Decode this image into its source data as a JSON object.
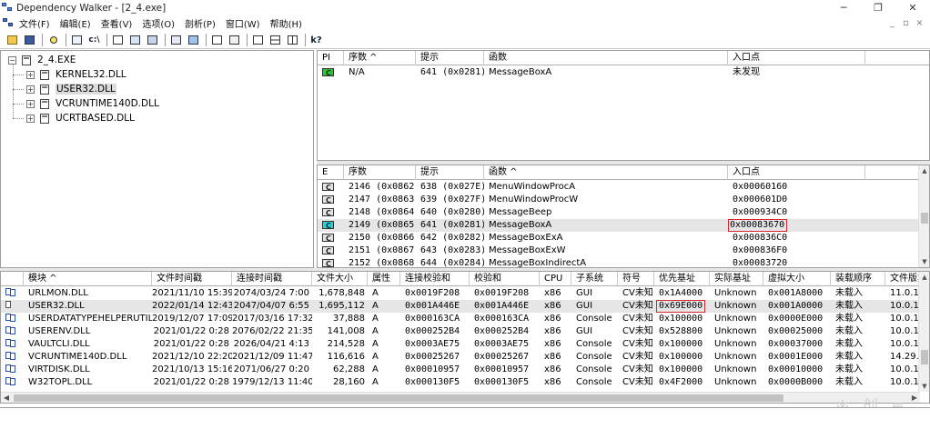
{
  "window": {
    "title": "Dependency Walker - [2_4.exe]",
    "controls": [
      "─",
      "❐",
      "✕"
    ]
  },
  "menu": {
    "items": [
      "文件(F)",
      "编辑(E)",
      "查看(V)",
      "选项(O)",
      "剖析(P)",
      "窗口(W)",
      "帮助(H)"
    ],
    "mdi_controls": [
      "_",
      "▫",
      "×"
    ]
  },
  "tree": {
    "root": "2_4.EXE",
    "children": [
      "KERNEL32.DLL",
      "USER32.DLL",
      "VCRUNTIME140D.DLL",
      "UCRTBASED.DLL"
    ],
    "selected_index": 1
  },
  "imports": {
    "headers": [
      "PI",
      "序数 ^",
      "提示",
      "函数",
      "入口点"
    ],
    "rows": [
      {
        "ordinal": "N/A",
        "hint": "641 (0x0281)",
        "function": "MessageBoxA",
        "entry": "未发现"
      }
    ]
  },
  "exports": {
    "headers": [
      "E",
      "序数",
      "提示",
      "函数 ^",
      "入口点"
    ],
    "rows": [
      {
        "ordinal": "2146 (0x0862)",
        "hint": "638 (0x027E)",
        "function": "MenuWindowProcA",
        "entry": "0x00060160"
      },
      {
        "ordinal": "2147 (0x0863)",
        "hint": "639 (0x027F)",
        "function": "MenuWindowProcW",
        "entry": "0x000601D0"
      },
      {
        "ordinal": "2148 (0x0864)",
        "hint": "640 (0x0280)",
        "function": "MessageBeep",
        "entry": "0x000934C0"
      },
      {
        "ordinal": "2149 (0x0865)",
        "hint": "641 (0x0281)",
        "function": "MessageBoxA",
        "entry": "0x00083670"
      },
      {
        "ordinal": "2150 (0x0866)",
        "hint": "642 (0x0282)",
        "function": "MessageBoxExA",
        "entry": "0x000836C0"
      },
      {
        "ordinal": "2151 (0x0867)",
        "hint": "643 (0x0283)",
        "function": "MessageBoxExW",
        "entry": "0x000836F0"
      },
      {
        "ordinal": "2152 (0x0868)",
        "hint": "644 (0x0284)",
        "function": "MessageBoxIndirectA",
        "entry": "0x00083720"
      }
    ],
    "highlighted_index": 3
  },
  "modules": {
    "headers": [
      "",
      "模块 ^",
      "文件时间戳",
      "连接时间戳",
      "文件大小",
      "属性",
      "连接校验和",
      "校验和",
      "CPU",
      "子系统",
      "符号",
      "优先基址",
      "实际基址",
      "虚拟大小",
      "装载顺序",
      "文件版本"
    ],
    "rows": [
      [
        "URLMON.DLL",
        "2021/11/10 15:39",
        "2074/03/24  7:00",
        "1,678,848",
        "A",
        "0x0019F208",
        "0x0019F208",
        "x86",
        "GUI",
        "CV未知",
        "0x1A4000",
        "Unknown",
        "0x001A8000",
        "未载入",
        "11.0.1"
      ],
      [
        "USER32.DLL",
        "2022/01/14 12:43",
        "2047/04/07  6:55",
        "1,695,112",
        "A",
        "0x001A446E",
        "0x001A446E",
        "x86",
        "GUI",
        "CV未知",
        "0x69E000",
        "Unknown",
        "0x001A0000",
        "未载入",
        "10.0.1"
      ],
      [
        "USERDATATYPEHELPERUTIL",
        "2019/12/07 17:09",
        "2017/03/16 17:32",
        "37,888",
        "A",
        "0x000163CA",
        "0x000163CA",
        "x86",
        "Console",
        "CV未知",
        "0x100000",
        "Unknown",
        "0x0000E000",
        "未载入",
        "10.0.1"
      ],
      [
        "USERENV.DLL",
        "2021/01/22  0:28",
        "2076/02/22 21:35",
        "141,008",
        "A",
        "0x000252B4",
        "0x000252B4",
        "x86",
        "GUI",
        "CV未知",
        "0x528800",
        "Unknown",
        "0x00025000",
        "未载入",
        "10.0.1"
      ],
      [
        "VAULTCLI.DLL",
        "2021/01/22  0:28",
        "2026/04/21  4:13",
        "214,528",
        "A",
        "0x0003AE75",
        "0x0003AE75",
        "x86",
        "Console",
        "CV未知",
        "0x100000",
        "Unknown",
        "0x00037000",
        "未载入",
        "10.0.1"
      ],
      [
        "VCRUNTIME140D.DLL",
        "2021/12/10 22:20",
        "2021/12/09 11:47",
        "116,616",
        "A",
        "0x00025267",
        "0x00025267",
        "x86",
        "Console",
        "CV未知",
        "0x100000",
        "Unknown",
        "0x0001E000",
        "未载入",
        "14.29."
      ],
      [
        "VIRTDISK.DLL",
        "2021/10/13 15:16",
        "2071/06/27  0:20",
        "62,288",
        "A",
        "0x00010957",
        "0x00010957",
        "x86",
        "Console",
        "CV未知",
        "0x100000",
        "Unknown",
        "0x00010000",
        "未载入",
        "10.0.1"
      ],
      [
        "W32TOPL.DLL",
        "2021/01/22  0:28",
        "1979/12/13 11:40",
        "28,160",
        "A",
        "0x000130F5",
        "0x000130F5",
        "x86",
        "Console",
        "CV未知",
        "0x4F2000",
        "Unknown",
        "0x0000B000",
        "未载入",
        "10.0.1"
      ]
    ],
    "selected_index": 1
  },
  "watermark": "※ 创 ≡"
}
